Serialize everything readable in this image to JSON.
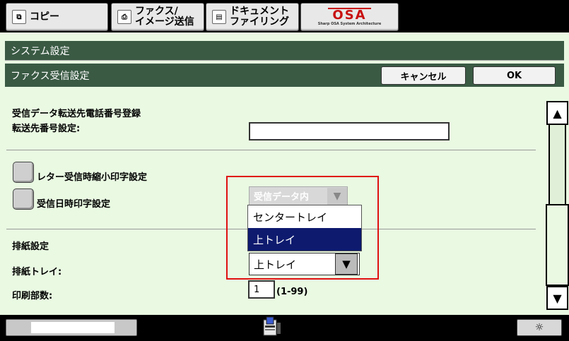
{
  "tabs": {
    "copy": "コピー",
    "fax_line1": "ファクス/",
    "fax_line2": "イメージ送信",
    "doc_line1": "ドキュメント",
    "doc_line2": "ファイリング",
    "osa_logo": "OSA",
    "osa_sub": "Sharp OSA System Architecture"
  },
  "header": {
    "system_settings": "システム設定",
    "fax_receive_settings": "ファクス受信設定",
    "cancel_label": "キャンセル",
    "ok_label": "OK"
  },
  "form": {
    "forward_title": "受信データ転送先電話番号登録",
    "forward_number_label": "転送先番号設定:",
    "forward_number_value": "",
    "letter_reduce_label": "レター受信時縮小印字設定",
    "datetime_print_label": "受信日時印字設定",
    "datetime_position_value": "受信データ内",
    "output_section_title": "排紙設定",
    "output_tray_label": "排紙トレイ:",
    "output_tray_options": [
      "センタートレイ",
      "上トレイ"
    ],
    "output_tray_selected": "上トレイ",
    "copies_label": "印刷部数:",
    "copies_value": "1",
    "copies_range": "(1-99)"
  },
  "colors": {
    "panel_bg": "#e9f9e2",
    "header_bar": "#3a5a44",
    "selected_option": "#0d1a6e",
    "highlight": "#e01010"
  },
  "icons": {
    "scroll_up": "▲",
    "scroll_down": "▼",
    "dropdown": "▼",
    "brightness": "☼"
  }
}
